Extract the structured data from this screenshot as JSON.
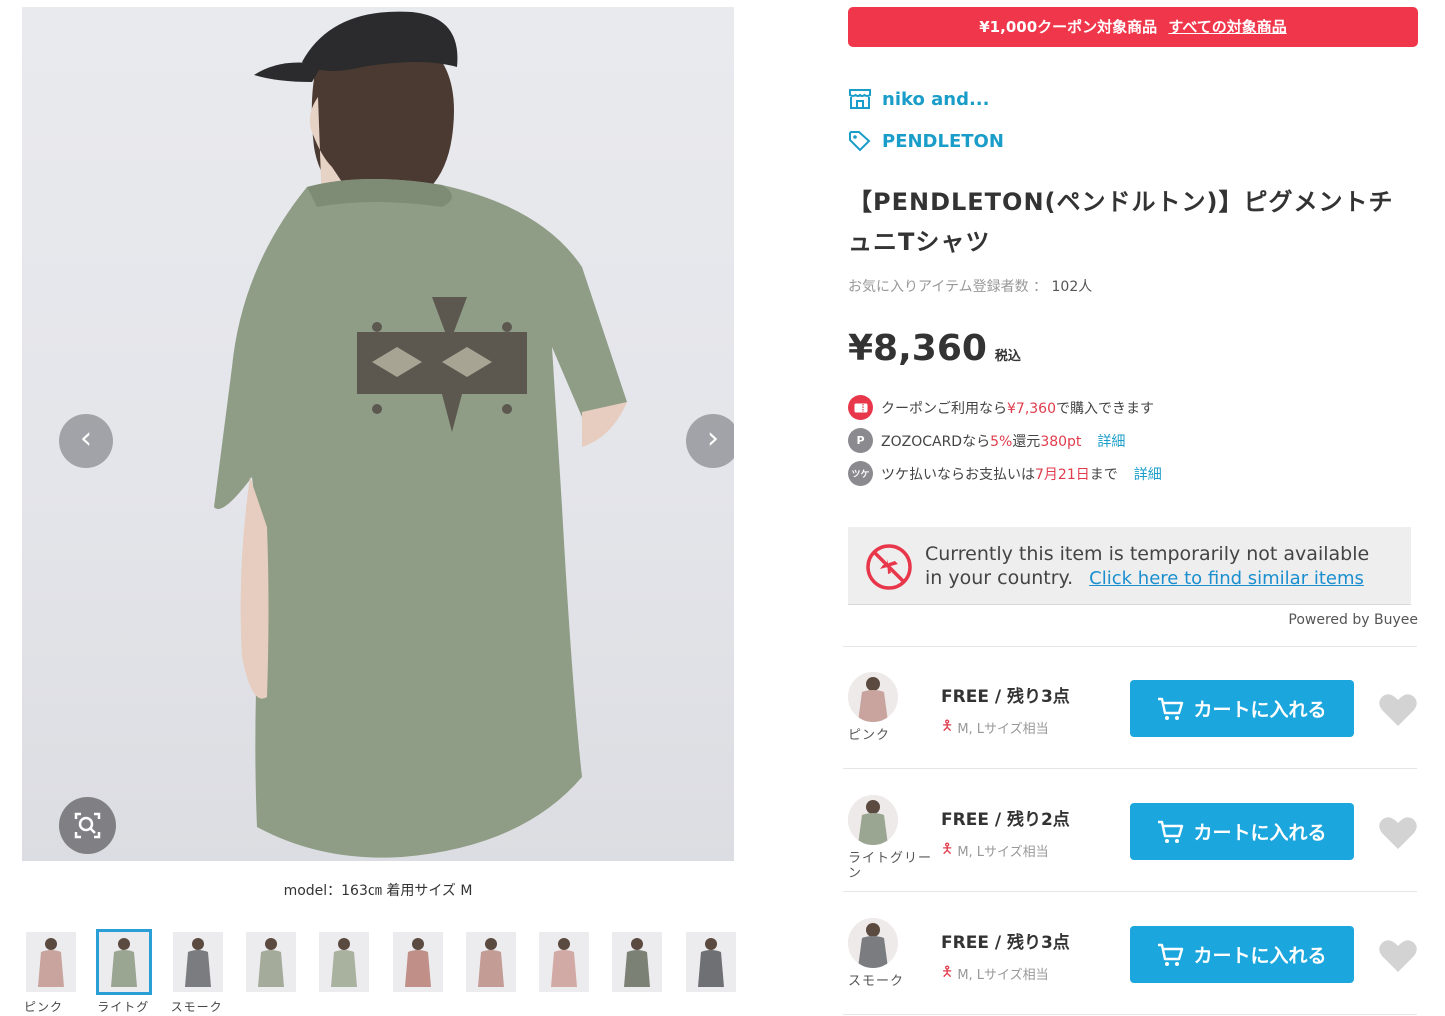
{
  "gallery": {
    "prev_icon": "chevron-left-icon",
    "next_icon": "chevron-right-icon",
    "zoom_icon": "image-search-icon",
    "model_caption": "model：163㎝ 着用サイズ M",
    "thumbnails": [
      {
        "label": "ピンク",
        "tone": "#c9a39d",
        "active": false
      },
      {
        "label": "ライトグ",
        "tone": "#9aa592",
        "active": true
      },
      {
        "label": "スモーク",
        "tone": "#7b7c7f",
        "active": false
      },
      {
        "label": "",
        "tone": "#a4ab9a",
        "active": false
      },
      {
        "label": "",
        "tone": "#a9b19f",
        "active": false
      },
      {
        "label": "",
        "tone": "#bf8f88",
        "active": false
      },
      {
        "label": "",
        "tone": "#c39c95",
        "active": false
      },
      {
        "label": "",
        "tone": "#d2aaa5",
        "active": false
      },
      {
        "label": "",
        "tone": "#7c8176",
        "active": false
      },
      {
        "label": "",
        "tone": "#6f7074",
        "active": false
      }
    ]
  },
  "coupon_banner": {
    "text": "¥1,000クーポン対象商品",
    "link": "すべての対象商品"
  },
  "shop": {
    "name": "niko and...",
    "icon": "store-icon"
  },
  "brand": {
    "name": "PENDLETON",
    "icon": "tag-icon"
  },
  "product": {
    "title": "【PENDLETON(ペンドルトン)】ピグメントチュニTシャツ",
    "favorites_label": "お気に入りアイテム登録者数 ：",
    "favorites_count": "102人",
    "price": "¥8,360",
    "tax_label": "税込"
  },
  "benefits": {
    "coupon": {
      "icon": "coupon-icon",
      "pre": "クーポンご利用なら",
      "amount": "¥7,360",
      "post": "で購入できます"
    },
    "zozocard": {
      "icon_text": "P",
      "pre": "ZOZOCARDなら",
      "rate": "5%",
      "mid": "還元",
      "points": "380pt",
      "link": "詳細"
    },
    "tsuke": {
      "icon_text": "ツケ",
      "pre": "ツケ払いならお支払いは",
      "date": "7月21日",
      "post": "まで",
      "link": "詳細"
    }
  },
  "availability": {
    "line1": "Currently this item is temporarily not available",
    "line2": "in your country.",
    "link": "Click here to find similar items",
    "powered_by": "Powered by Buyee"
  },
  "skus": [
    {
      "color": "ピンク",
      "size_stock": "FREE / 残り3点",
      "fit": "M, Lサイズ相当",
      "cart_label": "カートに入れる",
      "tone": "#c9a39d"
    },
    {
      "color": "ライトグリーン",
      "size_stock": "FREE / 残り2点",
      "fit": "M, Lサイズ相当",
      "cart_label": "カートに入れる",
      "tone": "#9aa592"
    },
    {
      "color": "スモーク",
      "size_stock": "FREE / 残り3点",
      "fit": "M, Lサイズ相当",
      "cart_label": "カートに入れる",
      "tone": "#7b7c7f"
    }
  ],
  "colors": {
    "accent_blue": "#1ba6dd",
    "coupon_red": "#f0364a",
    "link_blue": "#1a9dc9"
  }
}
